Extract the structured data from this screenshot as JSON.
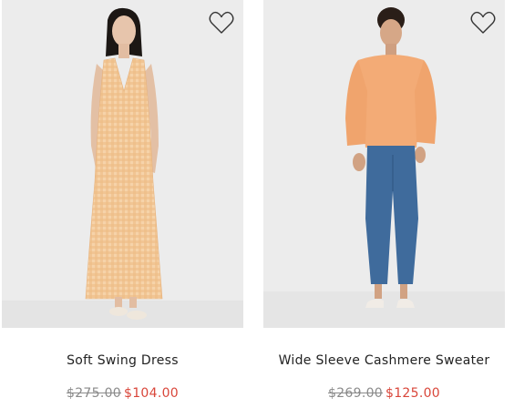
{
  "products": [
    {
      "name": "Soft Swing Dress",
      "original_price": "$275.00",
      "sale_price": "$104.00",
      "image": "woman-in-peach-gingham-sleeveless-maxi-dress",
      "wishlist_icon": "heart-outline-icon"
    },
    {
      "name": "Wide Sleeve Cashmere Sweater",
      "original_price": "$269.00",
      "sale_price": "$125.00",
      "image": "woman-in-peach-sweater-and-blue-jeans",
      "wishlist_icon": "heart-outline-icon"
    }
  ],
  "colors": {
    "sale_price": "#d9463a",
    "original_price": "#8a8a8a",
    "product_name": "#222222",
    "photo_background": "#ebebeb"
  }
}
